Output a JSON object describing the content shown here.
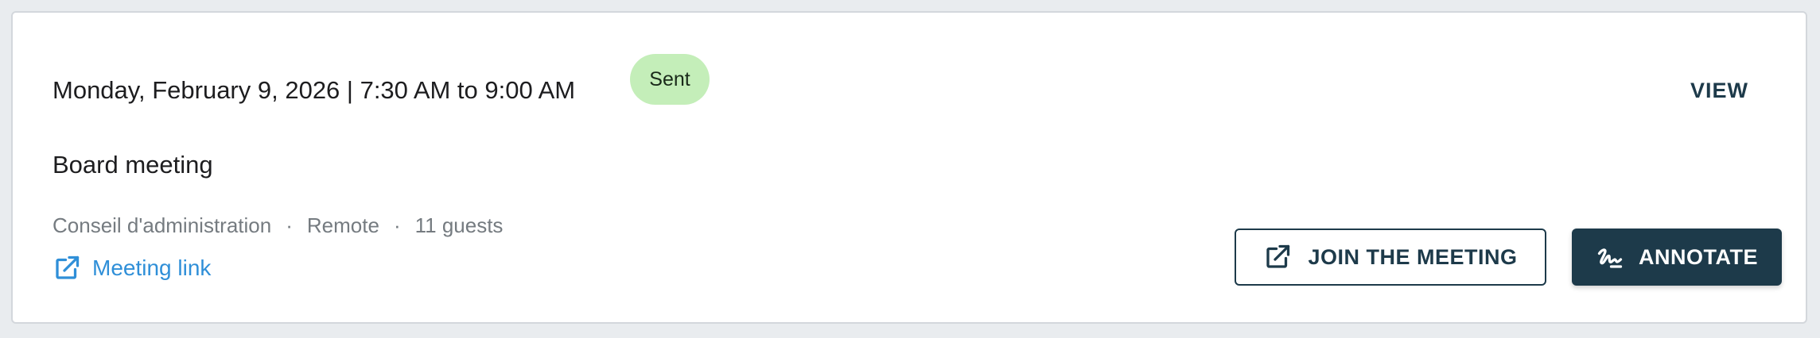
{
  "event": {
    "datetime": "Monday, February 9, 2026 | 7:30 AM to 9:00 AM",
    "status_badge": "Sent",
    "title": "Board meeting",
    "organization": "Conseil d'administration",
    "separator": "·",
    "location": "Remote",
    "guests": "11 guests",
    "meeting_link_label": "Meeting link"
  },
  "actions": {
    "view_label": "VIEW",
    "join_label": "JOIN THE MEETING",
    "annotate_label": "ANNOTATE"
  },
  "icons": {
    "meeting_link": "external-link-icon",
    "join": "external-link-icon",
    "annotate": "signature-icon"
  },
  "colors": {
    "badge_bg": "#c4eeb9",
    "primary": "#1d3a4a",
    "link": "#2f8fd8",
    "muted_text": "#757b80"
  }
}
